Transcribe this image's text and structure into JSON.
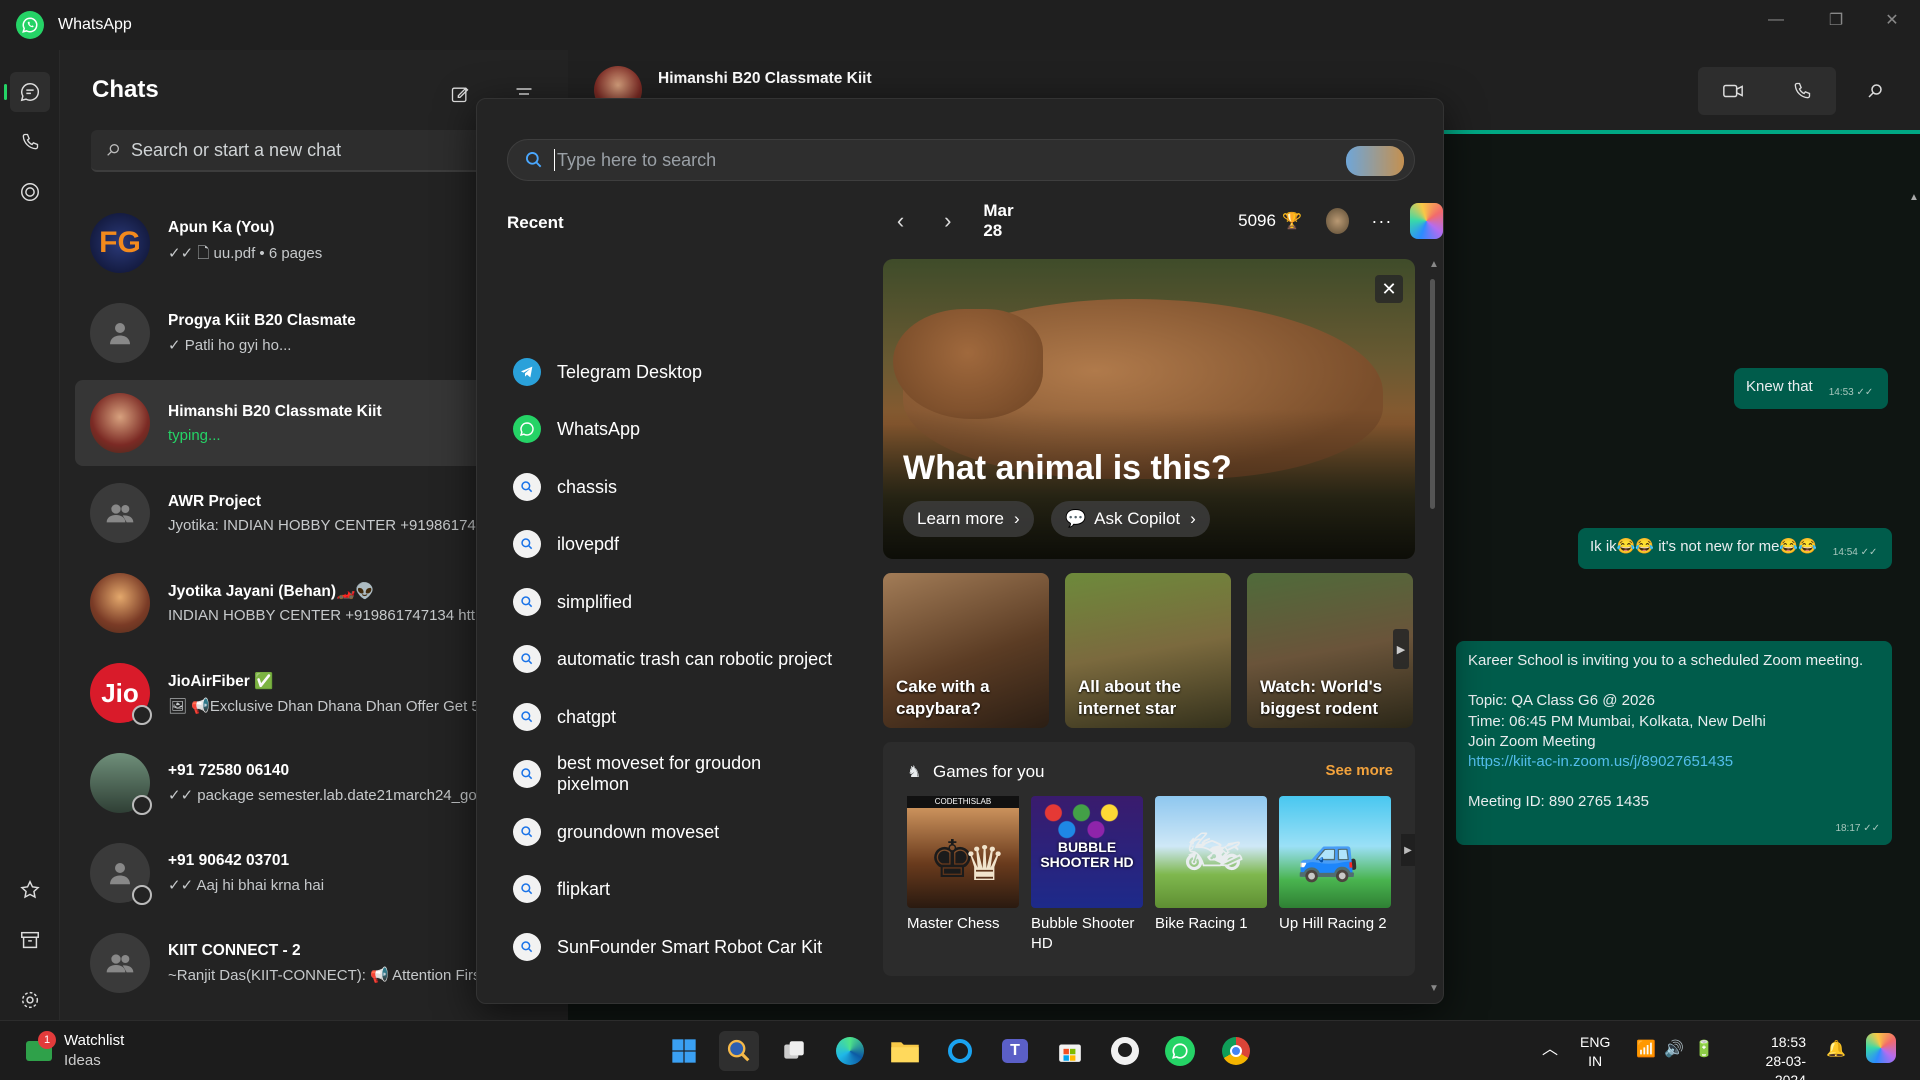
{
  "window": {
    "title": "WhatsApp"
  },
  "sidebar": {
    "header": "Chats",
    "search_placeholder": "Search or start a new chat"
  },
  "chats": [
    {
      "name": "Apun Ka (You)",
      "preview": "✓✓ 🗋 uu.pdf • 6 pages",
      "avatar_text": "FG"
    },
    {
      "name": "Progya Kiit B20 Clasmate",
      "preview": "✓ Patli ho gyi ho..."
    },
    {
      "name": "Himanshi B20 Classmate Kiit",
      "preview": "typing..."
    },
    {
      "name": "AWR Project",
      "preview": "Jyotika: INDIAN HOBBY CENTER +9198617471"
    },
    {
      "name": "Jyotika Jayani (Behan)🏎️👽",
      "preview": "INDIAN HOBBY CENTER +919861747134 https"
    },
    {
      "name": "JioAirFiber ✅",
      "preview": "🖼 📢Exclusive Dhan Dhana Dhan Offer  Get 5",
      "avatar_text": "Jio"
    },
    {
      "name": "+91 72580 06140",
      "preview": "✓✓ package semester.lab.date21march24_goog"
    },
    {
      "name": "+91 90642 03701",
      "preview": "✓✓ Aaj hi bhai krna hai"
    },
    {
      "name": "KIIT CONNECT - 2",
      "preview": "~Ranjit Das(KIIT-CONNECT): 📢 Attention First"
    }
  ],
  "chat_header": {
    "name": "Himanshi B20 Classmate Kiit"
  },
  "messages": [
    {
      "text": "Knew that",
      "time": "14:53 ✓✓"
    },
    {
      "text": "Ik ik😂😂 it's not new for me😂😂",
      "time": "14:54 ✓✓"
    },
    {
      "lines": [
        "Kareer School is inviting you to a scheduled Zoom meeting.",
        "",
        "Topic: QA Class G6 @ 2026",
        "Time: 06:45 PM Mumbai, Kolkata, New Delhi",
        "Join Zoom Meeting",
        "https://kiit-ac-in.zoom.us/j/89027651435",
        "",
        "Meeting ID: 890 2765 1435"
      ],
      "time": "18:17 ✓✓"
    }
  ],
  "search_panel": {
    "placeholder": "Type here to search",
    "recent_title": "Recent",
    "recent": [
      {
        "label": "Telegram Desktop",
        "icon": "telegram-icon"
      },
      {
        "label": "WhatsApp",
        "icon": "whatsapp-icon"
      },
      {
        "label": "chassis",
        "icon": "search-icon"
      },
      {
        "label": "ilovepdf",
        "icon": "search-icon"
      },
      {
        "label": "simplified",
        "icon": "search-icon"
      },
      {
        "label": "automatic trash can robotic project",
        "icon": "search-icon"
      },
      {
        "label": "chatgpt",
        "icon": "search-icon"
      },
      {
        "label": "best moveset for groudon pixelmon",
        "icon": "search-icon"
      },
      {
        "label": "groundown moveset",
        "icon": "search-icon"
      },
      {
        "label": "flipkart",
        "icon": "search-icon"
      },
      {
        "label": "SunFounder Smart Robot Car Kit",
        "icon": "search-icon"
      }
    ],
    "date": "Mar 28",
    "points": "5096",
    "hero": {
      "question": "What animal is this?",
      "learn_more": "Learn more",
      "ask_copilot": "Ask Copilot"
    },
    "cards": [
      {
        "caption": "Cake with a capybara?"
      },
      {
        "caption": "All about the internet star"
      },
      {
        "caption": "Watch: World's biggest rodent"
      }
    ],
    "games": {
      "title": "Games for you",
      "see_more": "See more",
      "items": [
        {
          "name": "Master Chess",
          "badge": "CODETHISLAB"
        },
        {
          "name": "Bubble Shooter HD",
          "badge": "BUBBLE SHOOTER HD"
        },
        {
          "name": "Bike Racing 1"
        },
        {
          "name": "Up Hill Racing 2"
        }
      ]
    }
  },
  "taskbar": {
    "widget_title": "Watchlist",
    "widget_sub": "Ideas",
    "widget_badge": "1",
    "lang_top": "ENG",
    "lang_bottom": "IN",
    "time": "18:53",
    "date": "28-03-2024"
  },
  "colors": {
    "accent": "#25d366",
    "bubble": "#005c4b",
    "panel": "#242424",
    "see_more": "#f2a23c"
  }
}
